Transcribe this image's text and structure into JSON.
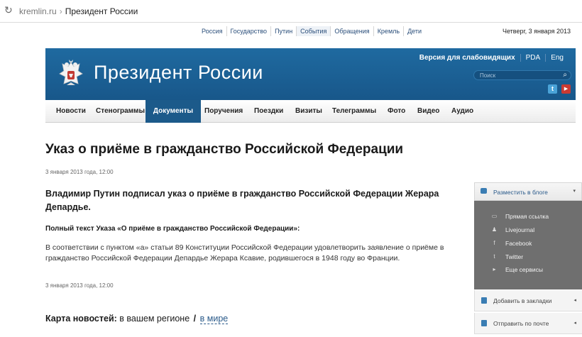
{
  "browser": {
    "host": "kremlin.ru",
    "separator": "›",
    "page_title": "Президент России"
  },
  "topnav": {
    "items": [
      "Россия",
      "Государство",
      "Путин",
      "События",
      "Обращения",
      "Кремль",
      "Дети"
    ],
    "active": "События",
    "date": "Четверг, 3 января 2013"
  },
  "header": {
    "title": "Президент России",
    "links": [
      "Версия для слабовидящих",
      "PDA",
      "Eng"
    ],
    "search_placeholder": "Поиск",
    "icons": [
      "coat-of-arms-icon",
      "search-icon",
      "twitter-icon",
      "youtube-icon"
    ]
  },
  "sections": {
    "items": [
      "Новости",
      "Стенограммы",
      "Документы",
      "Поручения",
      "Поездки",
      "Визиты",
      "Телеграммы",
      "Фото",
      "Видео",
      "Аудио"
    ],
    "active": "Документы"
  },
  "article": {
    "title": "Указ о приёме в гражданство Российской Федерации",
    "date_top": "3 января 2013 года, 12:00",
    "lead": "Владимир Путин подписал указ о приёме в гражданство Российской Федерации Жерара Депардье.",
    "subhead": "Полный текст Указа «О приёме в гражданство Российской Федерации»:",
    "body": "В соответствии с пунктом «а» статьи 89 Конституции Российской Федерации удовлетворить заявление о приёме в гражданство Российской Федерации Депардье Жерара Ксавие, родившегося в 1948 году во Франции.",
    "date_bottom": "3 января 2013 года, 12:00"
  },
  "news_map": {
    "label": "Карта новостей:",
    "region": "в вашем регионе",
    "slash": "/",
    "world": "в мире"
  },
  "share": {
    "blog": "Разместить в блоге",
    "items": [
      "Прямая ссылка",
      "Livejournal",
      "Facebook",
      "Twitter",
      "Еще сервисы"
    ],
    "bookmarks": "Добавить в закладки",
    "email": "Отправить по почте"
  }
}
